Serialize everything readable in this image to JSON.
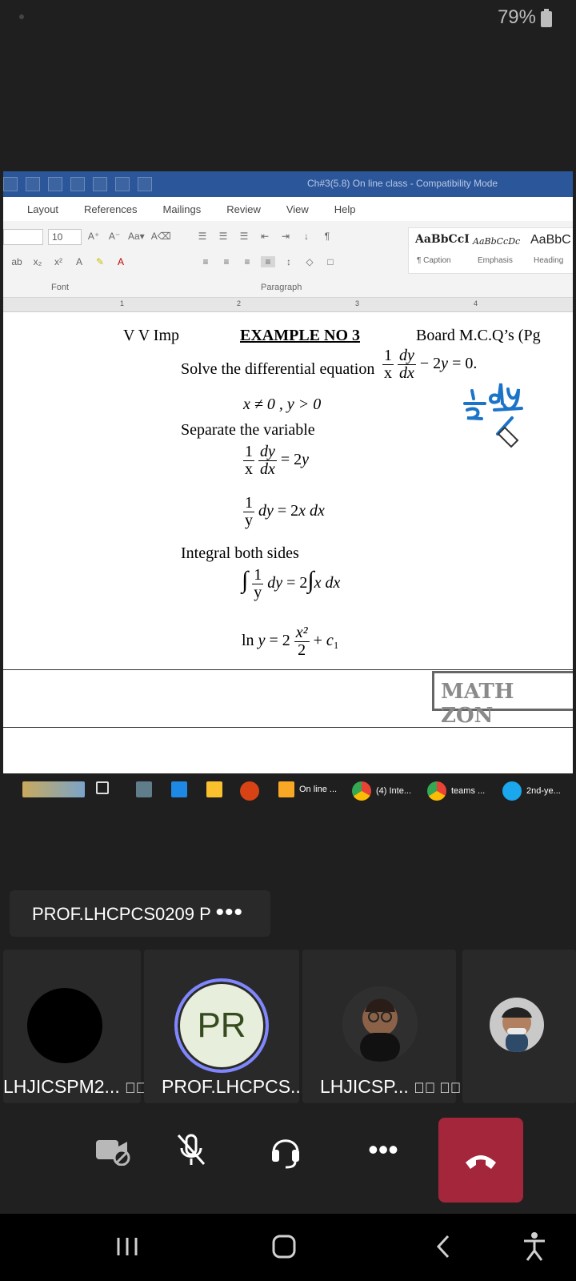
{
  "status": {
    "battery": "79%"
  },
  "shared_screen": {
    "title": "Ch#3(5.8) On line class - Compatibility Mode",
    "ribbon_tabs": [
      "Layout",
      "References",
      "Mailings",
      "Review",
      "View",
      "Help"
    ],
    "font_size": "10",
    "groups": {
      "font": "Font",
      "paragraph": "Paragraph"
    },
    "styles": [
      {
        "preview": "AaBbCcI",
        "name": "¶ Caption"
      },
      {
        "preview": "AaBbCcDc",
        "name": "Emphasis"
      },
      {
        "preview": "AaBbC",
        "name": "Heading"
      }
    ],
    "ruler_numbers": [
      "1",
      "2",
      "3",
      "4"
    ],
    "document": {
      "left_heading": "V V Imp",
      "center_heading": "EXAMPLE NO 3",
      "right_heading": "Board M.C.Q’s (Pg",
      "solve_text": "Solve the differential equation",
      "condition": "x ≠ 0 , y > 0",
      "separate": "Separate the variable",
      "integral_text": "Integral both sides",
      "stamp": "MATH ZON"
    },
    "taskbar": {
      "items": [
        "On line ...",
        "(4) Inte...",
        "teams ...",
        "2nd-ye..."
      ]
    }
  },
  "meeting": {
    "presenter_card": "PROF.LHCPCS0209 P",
    "more": "•••",
    "participants": [
      {
        "label": "LHJICSPM2...",
        "status": "video-off"
      },
      {
        "label": "PROF.LHCPCS...",
        "initials": "PR"
      },
      {
        "label": "LHJICSP...",
        "status": "muted-video-off"
      },
      {
        "label": "",
        "status": "photo"
      }
    ]
  },
  "controls": {
    "camera": "camera-off-icon",
    "mic": "mic-off-icon",
    "audio": "headset-icon",
    "more": "•••",
    "leave": "phone-hangup-icon"
  }
}
